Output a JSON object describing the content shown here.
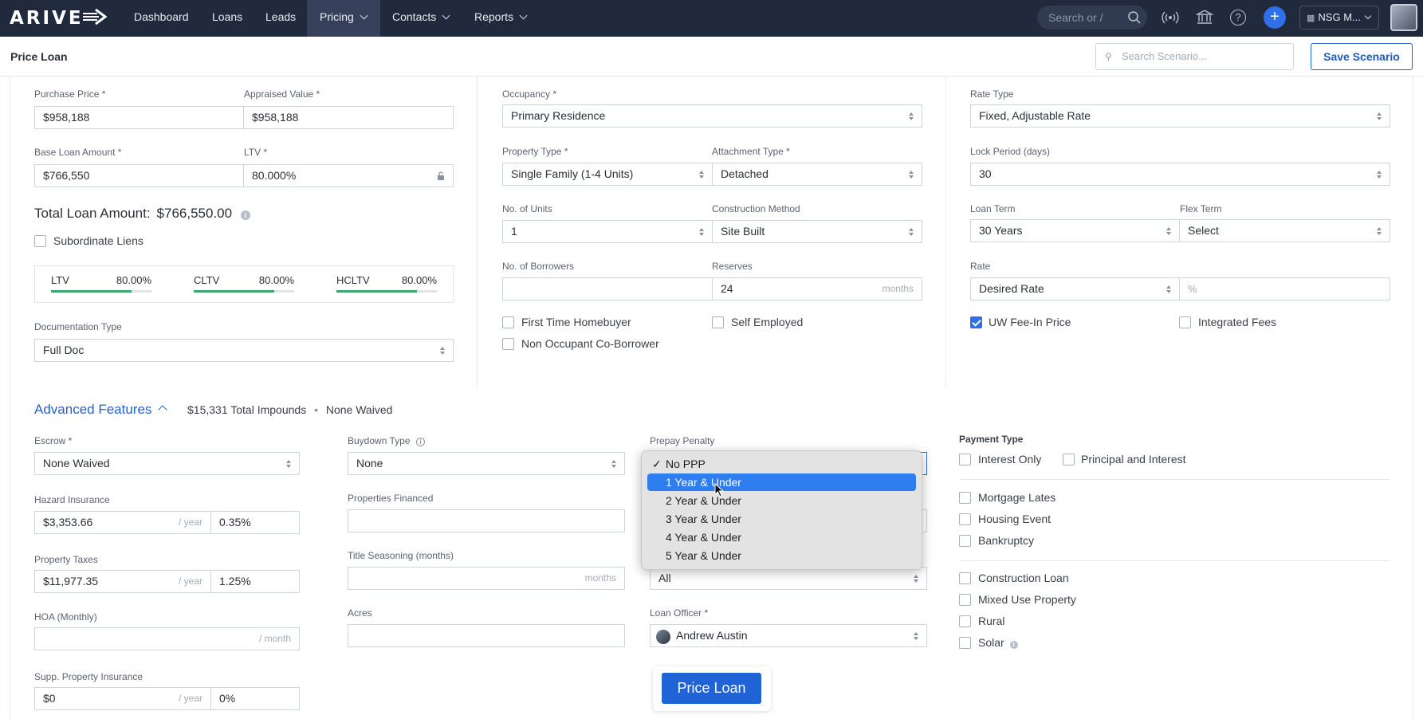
{
  "nav": {
    "logo": "ARIVE",
    "items": [
      {
        "label": "Dashboard",
        "dropdown": false
      },
      {
        "label": "Loans",
        "dropdown": false
      },
      {
        "label": "Leads",
        "dropdown": false
      },
      {
        "label": "Pricing",
        "dropdown": true
      },
      {
        "label": "Contacts",
        "dropdown": true
      },
      {
        "label": "Reports",
        "dropdown": true
      }
    ],
    "search_placeholder": "Search or /",
    "org": "NSG M...",
    "icons": [
      "broadcast-icon",
      "bank-icon",
      "help-icon",
      "plus-icon"
    ],
    "plus": "+",
    "help": "?"
  },
  "header": {
    "title": "Price Loan",
    "search_placeholder": "Search Scenario...",
    "save_label": "Save Scenario"
  },
  "loan": {
    "purchase_price_label": "Purchase Price *",
    "purchase_price": "$958,188",
    "appraised_value_label": "Appraised Value *",
    "appraised_value": "$958,188",
    "base_loan_label": "Base Loan Amount *",
    "base_loan": "$766,550",
    "ltv_label": "LTV *",
    "ltv": "80.000%",
    "total_label": "Total Loan Amount:",
    "total_value": "$766,550.00",
    "subordinate_label": "Subordinate Liens",
    "ratios": [
      {
        "label": "LTV",
        "value": "80.00%",
        "pct": 80
      },
      {
        "label": "CLTV",
        "value": "80.00%",
        "pct": 80
      },
      {
        "label": "HCLTV",
        "value": "80.00%",
        "pct": 80
      }
    ],
    "doc_type_label": "Documentation Type",
    "doc_type": "Full Doc"
  },
  "property": {
    "occupancy_label": "Occupancy *",
    "occupancy": "Primary Residence",
    "property_type_label": "Property Type *",
    "property_type": "Single Family (1-4 Units)",
    "attachment_label": "Attachment Type *",
    "attachment": "Detached",
    "units_label": "No. of Units",
    "units": "1",
    "construction_label": "Construction Method",
    "construction": "Site Built",
    "borrowers_label": "No. of Borrowers",
    "borrowers": "",
    "reserves_label": "Reserves",
    "reserves": "24",
    "reserves_suffix": "months",
    "first_time_label": "First Time Homebuyer",
    "self_employed_label": "Self Employed",
    "non_occupant_label": "Non Occupant Co-Borrower"
  },
  "rate": {
    "rate_type_label": "Rate Type",
    "rate_type": "Fixed, Adjustable Rate",
    "lock_label": "Lock Period (days)",
    "lock": "30",
    "term_label": "Loan Term",
    "term": "30 Years",
    "flex_label": "Flex Term",
    "flex": "Select",
    "rate_label": "Rate",
    "rate_mode": "Desired Rate",
    "rate_suffix": "%",
    "uw_fee_label": "UW Fee-In Price",
    "uw_fee_checked": true,
    "integrated_label": "Integrated Fees"
  },
  "advanced": {
    "title": "Advanced Features",
    "impounds": "$15,331 Total Impounds",
    "bullet": "•",
    "waived": "None Waived",
    "escrow_label": "Escrow *",
    "escrow": "None Waived",
    "hazard_label": "Hazard Insurance",
    "hazard_amount": "$3,353.66",
    "hazard_pct": "0.35%",
    "per_year": "/ year",
    "taxes_label": "Property Taxes",
    "taxes_amount": "$11,977.35",
    "taxes_pct": "1.25%",
    "hoa_label": "HOA (Monthly)",
    "per_month": "/ month",
    "supp_label": "Supp. Property Insurance",
    "supp_amount": "$0",
    "supp_pct": "0%",
    "buydown_label": "Buydown Type",
    "buydown": "None",
    "financed_label": "Properties Financed",
    "seasoning_label": "Title Seasoning (months)",
    "seasoning_suffix": "months",
    "acres_label": "Acres",
    "prepay_label": "Prepay Penalty",
    "hidden_select_value": "All",
    "loan_officer_label": "Loan Officer *",
    "loan_officer": "Andrew Austin",
    "price_button": "Price Loan",
    "payment_type_label": "Payment Type",
    "interest_only_label": "Interest Only",
    "principal_interest_label": "Principal and Interest",
    "mortgage_lates_label": "Mortgage Lates",
    "housing_event_label": "Housing Event",
    "bankruptcy_label": "Bankruptcy",
    "construction_loan_label": "Construction Loan",
    "mixed_use_label": "Mixed Use Property",
    "rural_label": "Rural",
    "solar_label": "Solar"
  },
  "prepay_dropdown": {
    "selected_mark": "✓",
    "options": [
      "No PPP",
      "1 Year & Under",
      "2 Year & Under",
      "3 Year & Under",
      "4 Year & Under",
      "5 Year & Under"
    ],
    "selected_index": 0,
    "highlighted_index": 1
  },
  "info_glyph": "i",
  "colors": {
    "nav_bg": "#212a3d",
    "accent": "#2563c9",
    "highlight": "#2f7ef0",
    "ratio_bar": "#3aa86b"
  }
}
